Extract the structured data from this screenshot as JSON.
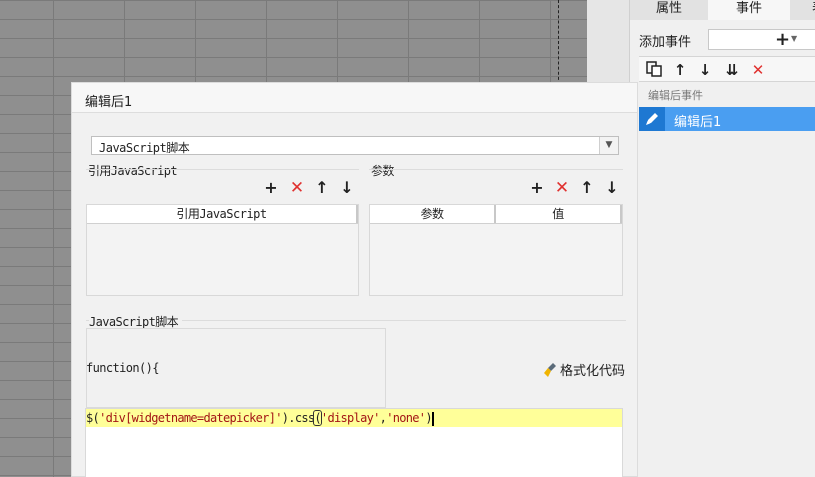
{
  "right_panel": {
    "tabs": [
      "属性",
      "事件",
      "表"
    ],
    "add_event_label": "添加事件",
    "add_event_button": "+",
    "section_title": "编辑后事件",
    "events": [
      {
        "label": "编辑后1",
        "selected": true
      }
    ],
    "toolbar_icons": [
      "copy-icon",
      "arrow-up-icon",
      "arrow-down-icon",
      "move-bottom-icon",
      "delete-icon"
    ]
  },
  "dialog": {
    "title": "编辑后1",
    "type_select": {
      "value": "JavaScript脚本"
    },
    "ref_js": {
      "label": "引用JavaScript",
      "columns": [
        "引用JavaScript"
      ],
      "rows": []
    },
    "params": {
      "label": "参数",
      "columns": [
        "参数",
        "值"
      ],
      "rows": []
    },
    "script": {
      "label": "JavaScript脚本",
      "func_header": "function(){",
      "format_button": "格式化代码",
      "code_parts": {
        "p1": "$(",
        "p2": "'div[widgetname=datepicker]'",
        "p3": ").css",
        "p4": "(",
        "p5": "'display'",
        "p6": ",",
        "p7": "'none'",
        "p8": ")"
      }
    }
  },
  "colors": {
    "selection": "#4a9ef1",
    "delete_red": "#e0312f",
    "code_highlight": "#ffff99",
    "string_literal": "#a31515"
  }
}
